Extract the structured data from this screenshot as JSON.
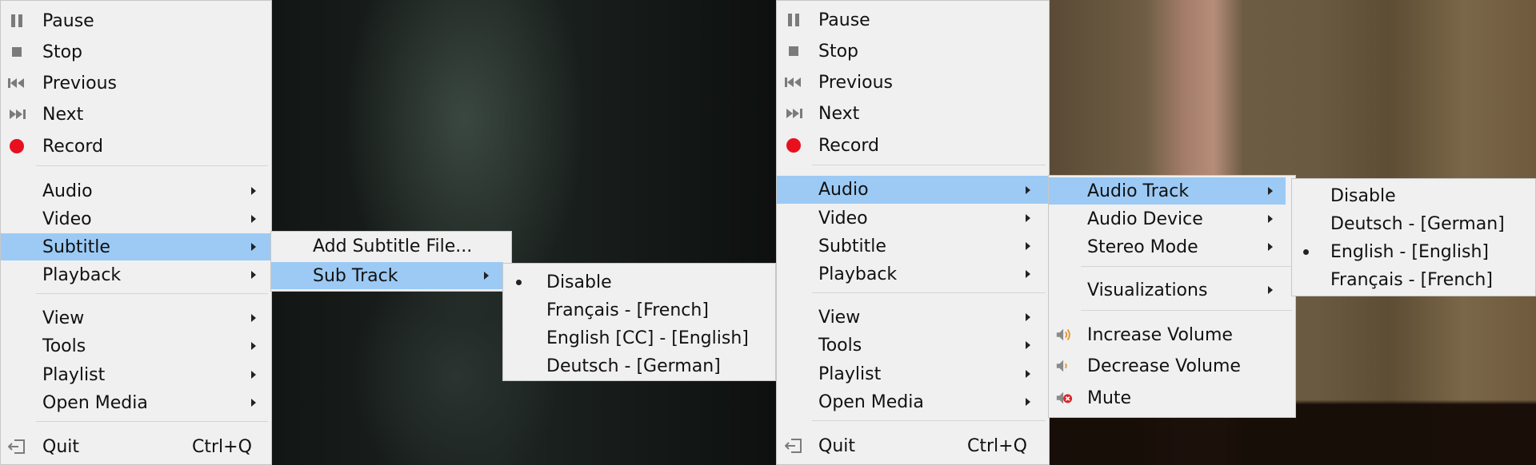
{
  "left_panel": {
    "main_menu": {
      "pause": "Pause",
      "stop": "Stop",
      "previous": "Previous",
      "next": "Next",
      "record": "Record",
      "audio": "Audio",
      "video": "Video",
      "subtitle": "Subtitle",
      "playback": "Playback",
      "view": "View",
      "tools": "Tools",
      "playlist": "Playlist",
      "open_media": "Open Media",
      "quit": "Quit",
      "quit_shortcut": "Ctrl+Q"
    },
    "subtitle_menu": {
      "add_file": "Add Subtitle File...",
      "sub_track": "Sub Track"
    },
    "sub_track_menu": {
      "items": [
        "Disable",
        "Français - [French]",
        "English [CC] - [English]",
        "Deutsch - [German]"
      ],
      "selected": "Disable"
    }
  },
  "right_panel": {
    "main_menu": {
      "pause": "Pause",
      "stop": "Stop",
      "previous": "Previous",
      "next": "Next",
      "record": "Record",
      "audio": "Audio",
      "video": "Video",
      "subtitle": "Subtitle",
      "playback": "Playback",
      "view": "View",
      "tools": "Tools",
      "playlist": "Playlist",
      "open_media": "Open Media",
      "quit": "Quit",
      "quit_shortcut": "Ctrl+Q"
    },
    "audio_menu": {
      "audio_track": "Audio Track",
      "audio_device": "Audio Device",
      "stereo_mode": "Stereo Mode",
      "visualizations": "Visualizations",
      "increase_volume": "Increase Volume",
      "decrease_volume": "Decrease Volume",
      "mute": "Mute"
    },
    "audio_track_menu": {
      "items": [
        "Disable",
        "Deutsch - [German]",
        "English - [English]",
        "Français - [French]"
      ],
      "selected": "English - [English]"
    }
  },
  "colors": {
    "menu_bg": "#f0f0f0",
    "highlight": "#9ccaf5",
    "record_red": "#e8101e",
    "separator": "#d5d5d5"
  },
  "icons": {
    "pause": "pause-icon",
    "stop": "stop-icon",
    "previous": "previous-icon",
    "next": "next-icon",
    "record": "record-icon",
    "quit": "exit-icon",
    "increase_volume": "volume-up-icon",
    "decrease_volume": "volume-down-icon",
    "mute": "mute-icon",
    "submenu": "chevron-right-icon",
    "selected": "bullet-icon"
  }
}
